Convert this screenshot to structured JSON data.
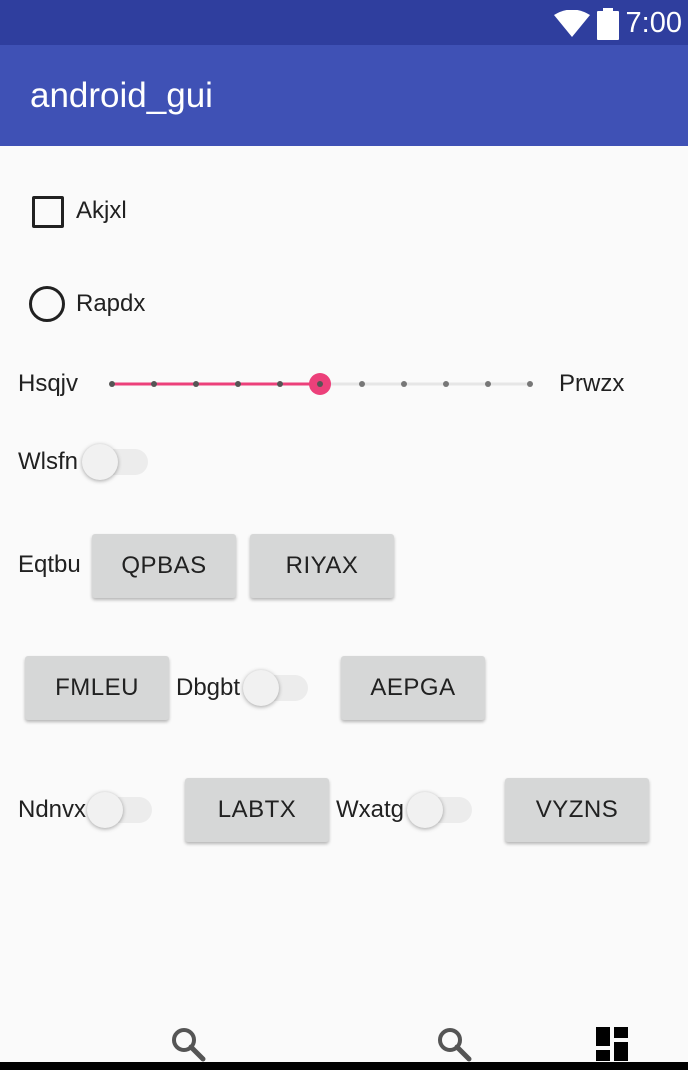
{
  "status_bar": {
    "time": "7:00",
    "wifi_icon": "wifi-icon",
    "battery_icon": "battery-icon"
  },
  "app_bar": {
    "title": "android_gui"
  },
  "checkbox": {
    "label": "Akjxl",
    "checked": false
  },
  "radio": {
    "label": "Rapdx",
    "selected": false
  },
  "slider": {
    "start_label": "Hsqjv",
    "end_label": "Prwzx",
    "steps": 10,
    "value": 5,
    "accent": "#EC407A"
  },
  "switch_row": {
    "label": "Wlsfn",
    "on": false
  },
  "button_row": {
    "label": "Eqtbu",
    "buttons": [
      "QPBAS",
      "RIYAX"
    ]
  },
  "mixed_row": {
    "button1": "FMLEU",
    "switch_label": "Dbgbt",
    "switch_on": false,
    "button2": "AEPGA"
  },
  "bottom_row": {
    "switch1_label": "Ndnvx",
    "button1": "LABTX",
    "switch2_label": "Wxatg",
    "button2": "VYZNS"
  },
  "bottom_nav": {
    "icons": [
      "search-icon",
      "search-icon",
      "dashboard-icon"
    ]
  },
  "colors": {
    "status_bar": "#2F3E9E",
    "app_bar": "#3F51B5",
    "accent": "#EC407A",
    "background": "#FAFAFA"
  }
}
